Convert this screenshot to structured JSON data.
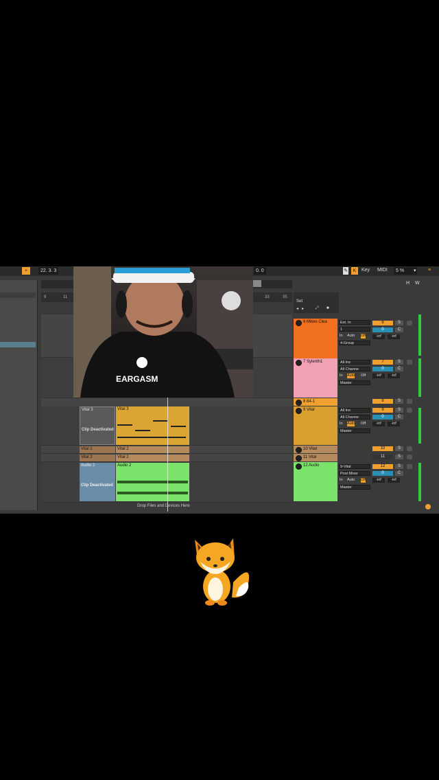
{
  "transport": {
    "position": "22. 3. 3",
    "tempo_readout": "0. 0",
    "key_label": "Key",
    "midi_label": "MIDI",
    "zoom": "5 %",
    "h_label": "H",
    "w_label": "W"
  },
  "arrangement": {
    "ruler": [
      "9",
      "11",
      "33",
      "35"
    ],
    "drop_hint": "Drop Files and Devices Here",
    "clips": {
      "vital3_deact_name": "Vital 3",
      "vital3_deact_label": "Clip Deactivated",
      "vital3_name": "Vital 3",
      "vital2_a": "Vital 2",
      "vital2_b": "Vital 2",
      "vital2_c": "Vital 2",
      "vital2_d": "Vital 2",
      "audio2_deact_name": "Audio 2",
      "audio2_deact_label": "Clip Deactivated",
      "audio2_name": "Audio 2"
    }
  },
  "session": {
    "set_label": "Set",
    "tracks": [
      {
        "name": "6 Mikes Clea",
        "color": "#f07020"
      },
      {
        "name": "7 Sylenth1",
        "color": "#f2a0b4"
      },
      {
        "name": "8 84-1",
        "color": "#f0a030"
      },
      {
        "name": "9 Vital",
        "color": "#d9a030"
      },
      {
        "name": "10 Vital",
        "color": "#b58a5c"
      },
      {
        "name": "11 Vital",
        "color": "#b58a5c"
      },
      {
        "name": "12 Audio",
        "color": "#7be36a"
      }
    ]
  },
  "io": {
    "t6": {
      "input": "Ext. In",
      "channel": "1",
      "monitor_in": "In",
      "monitor_auto": "Auto",
      "monitor_off": "Off",
      "output": "4-Group"
    },
    "t7": {
      "input": "All Ins",
      "channel": "All Channe",
      "monitor_in": "In",
      "monitor_auto": "Auto",
      "monitor_off": "Off",
      "output": "Master"
    },
    "t9": {
      "input": "All Ins",
      "channel": "All Channe",
      "monitor_in": "In",
      "monitor_auto": "Auto",
      "monitor_off": "Off",
      "output": "Master"
    },
    "t12": {
      "input": "9-Vital",
      "channel": "Post Mixer",
      "monitor_in": "In",
      "monitor_auto": "Auto",
      "monitor_off": "Off",
      "output": "Master"
    }
  },
  "mixer": {
    "t6": {
      "vol": "6",
      "pan": "0",
      "solo": "S",
      "c": "C",
      "inf1": "-inf",
      "inf2": "-inf"
    },
    "t7": {
      "vol": "7",
      "pan": "0",
      "solo": "S",
      "c": "C",
      "inf1": "-inf",
      "inf2": "-inf"
    },
    "t8": {
      "vol": "8",
      "solo": "S"
    },
    "t9": {
      "vol": "9",
      "pan": "0",
      "solo": "S",
      "c": "C",
      "inf1": "-inf",
      "inf2": "-inf"
    },
    "t10": {
      "vol": "10",
      "solo": "S"
    },
    "t11": {
      "vol": "11",
      "solo": "S"
    },
    "t12": {
      "vol": "12",
      "pan": "0",
      "solo": "S",
      "c": "C",
      "inf1": "-inf",
      "inf2": "-inf"
    }
  },
  "webcam": {
    "shirt_text": "EARGASM"
  }
}
